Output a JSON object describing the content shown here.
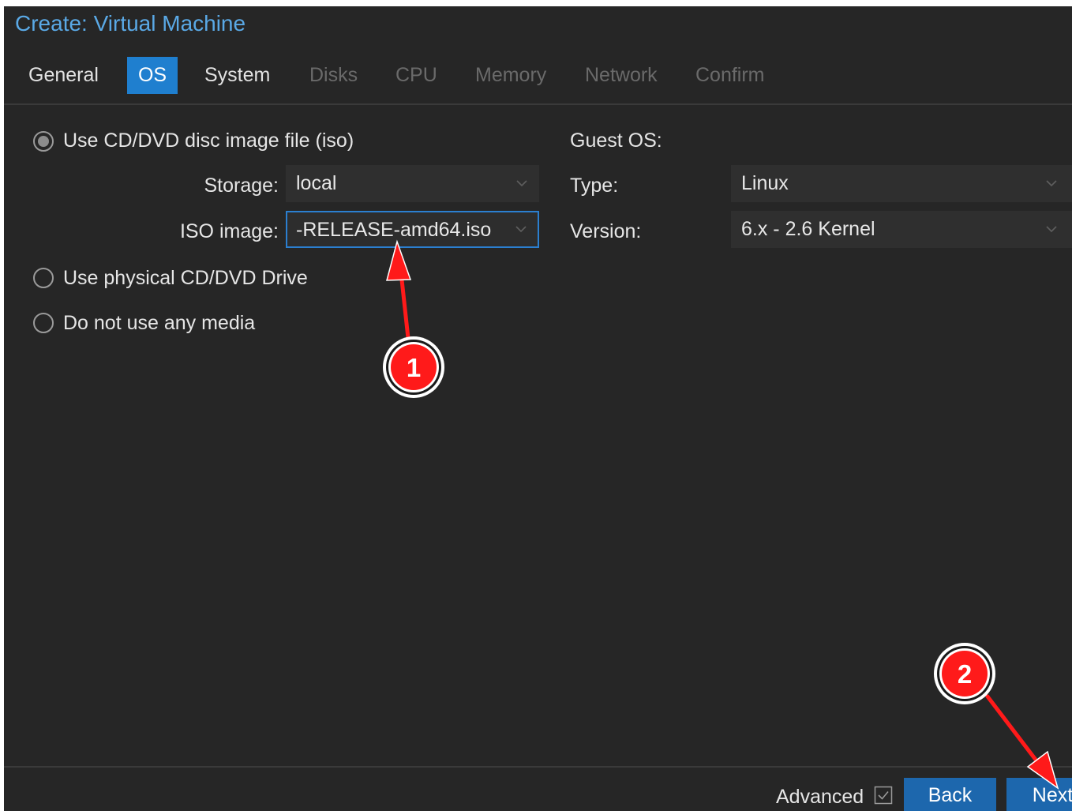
{
  "window": {
    "title": "Create: Virtual Machine"
  },
  "tabs": [
    {
      "label": "General",
      "state": "normal"
    },
    {
      "label": "OS",
      "state": "active"
    },
    {
      "label": "System",
      "state": "normal"
    },
    {
      "label": "Disks",
      "state": "disabled"
    },
    {
      "label": "CPU",
      "state": "disabled"
    },
    {
      "label": "Memory",
      "state": "disabled"
    },
    {
      "label": "Network",
      "state": "disabled"
    },
    {
      "label": "Confirm",
      "state": "disabled"
    }
  ],
  "media": {
    "option_iso": "Use CD/DVD disc image file (iso)",
    "storage_label": "Storage:",
    "storage_value": "local",
    "iso_label": "ISO image:",
    "iso_value": "-RELEASE-amd64.iso",
    "option_physical": "Use physical CD/DVD Drive",
    "option_none": "Do not use any media"
  },
  "guest_os": {
    "heading": "Guest OS:",
    "type_label": "Type:",
    "type_value": "Linux",
    "version_label": "Version:",
    "version_value": "6.x - 2.6 Kernel"
  },
  "footer": {
    "advanced_label": "Advanced",
    "back_label": "Back",
    "next_label": "Next"
  },
  "annotations": {
    "marker_1": "1",
    "marker_2": "2",
    "color": "#ff1a1a"
  },
  "colors": {
    "accent": "#1f7fcf",
    "title": "#5aa9e6",
    "background": "#262626"
  },
  "icons": {
    "dropdown": "chevron-down-icon",
    "checkbox": "checkbox-checked-icon"
  }
}
